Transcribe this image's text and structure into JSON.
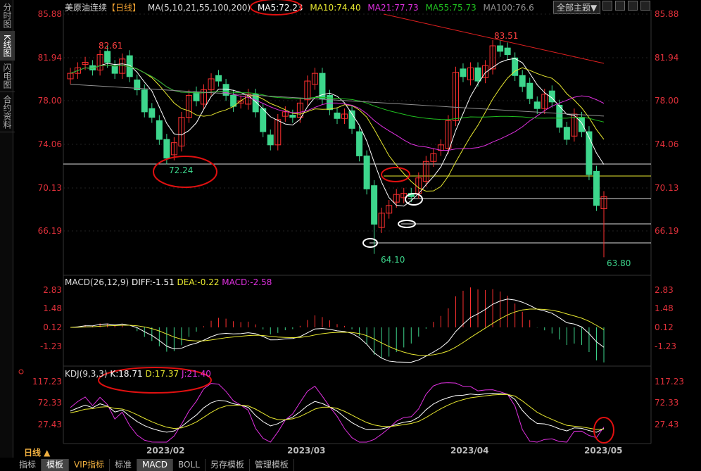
{
  "sidebar": [
    "分时图",
    "K线图",
    "闪电图",
    "合约资料"
  ],
  "header": {
    "title": "美原油连续",
    "period": "【日线】",
    "ma_params": "MA(5,10,21,55,100,200)",
    "ma5": "MA5:72.23",
    "ma10": "MA10:74.40",
    "ma21": "MA21:77.73",
    "ma55": "MA55:75.73",
    "ma100": "MA100:76.6",
    "theme_button": "全部主题▼"
  },
  "price_axis": [
    "85.88",
    "81.94",
    "78.00",
    "74.06",
    "70.13",
    "66.19"
  ],
  "price_annotations": {
    "high1": "82.61",
    "low1": "72.24",
    "low2": "64.10",
    "high2": "83.51",
    "low3": "63.80"
  },
  "macd": {
    "label": "MACD(26,12,9)",
    "diff": "DIFF:-1.51",
    "dea": "DEA:-0.22",
    "macd": "MACD:-2.58",
    "axis": [
      "2.83",
      "1.48",
      "0.12",
      "-1.23"
    ]
  },
  "kdj": {
    "label": "KDJ(9,3,3)",
    "k": "K:18.71",
    "d": "D:17.37",
    "j": "J:21.40",
    "axis": [
      "117.23",
      "72.33",
      "27.43"
    ]
  },
  "dates": [
    "2023/02",
    "2023/03",
    "2023/04",
    "2023/05"
  ],
  "period_label": "日线 ▲",
  "tabs": [
    "指标",
    "模板",
    "VIP指标",
    "标准",
    "MACD",
    "BOLL",
    "另存模板",
    "管理模板"
  ],
  "colors": {
    "up": "#ff3030",
    "down": "#3dd68c",
    "ma5": "#ffffff",
    "ma10": "#e8e830",
    "ma21": "#e030e0",
    "ma55": "#20c020",
    "ma100": "#909090",
    "ma200": "#e02020"
  },
  "closes": [
    80.5,
    81,
    81.5,
    80.8,
    82.2,
    81.5,
    80.5,
    81.8,
    80.2,
    79,
    77,
    76.5,
    74.5,
    72.8,
    74.2,
    76.5,
    78.5,
    78,
    79,
    80,
    79.8,
    78.5,
    77.5,
    78,
    78.6,
    77,
    75.2,
    74,
    76.3,
    77,
    76.5,
    77.8,
    79.8,
    80.5,
    78.2,
    77.2,
    76.4,
    76.8,
    75.5,
    73,
    70,
    66.8,
    67.8,
    68.5,
    69.5,
    69.6,
    69.3,
    71,
    72.5,
    73.2,
    74,
    76.2,
    80.6,
    80.2,
    81,
    79.8,
    81.2,
    83,
    82.5,
    82.2,
    80.3,
    79.3,
    78.2,
    77.3,
    78.6,
    77.9,
    75.6,
    74.5,
    76.8,
    75.2,
    71.3,
    68.5,
    69.3
  ]
}
